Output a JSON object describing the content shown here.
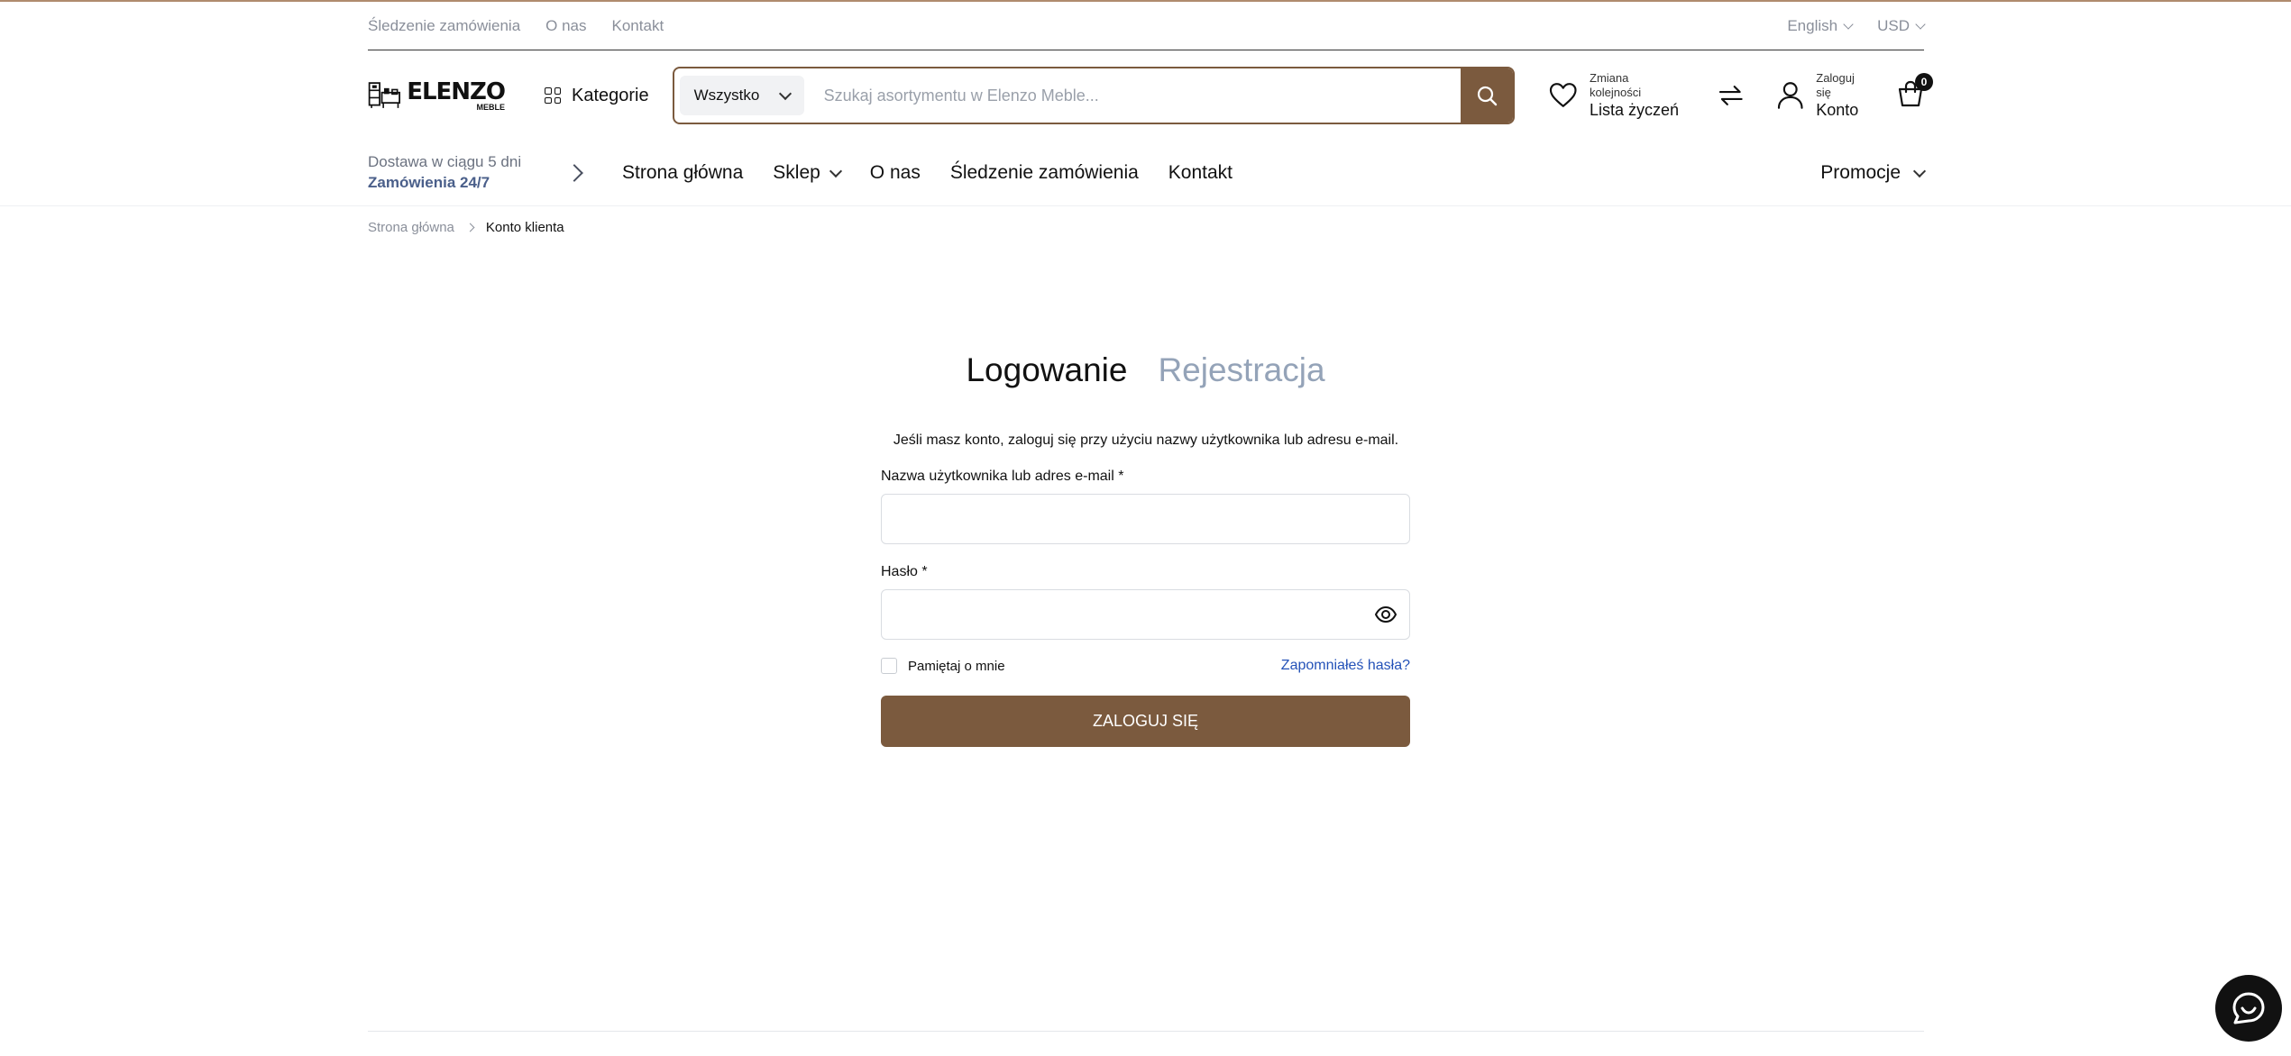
{
  "topbar": {
    "links": [
      "Śledzenie zamówienia",
      "O nas",
      "Kontakt"
    ],
    "language": "English",
    "currency": "USD"
  },
  "header": {
    "logo_brand": "ELENZO",
    "logo_sub": "MEBLE",
    "categories_label": "Kategorie",
    "search_category": "Wszystko",
    "search_placeholder": "Szukaj asortymentu w Elenzo Meble...",
    "wishlist_small": "Zmiana kolejności",
    "wishlist_big": "Lista życzeń",
    "account_small": "Zaloguj się",
    "account_big": "Konto",
    "cart_count": "0"
  },
  "nav": {
    "delivery_line1": "Dostawa w ciągu 5 dni",
    "delivery_line2": "Zamówienia 24/7",
    "items": [
      "Strona główna",
      "Sklep",
      "O nas",
      "Śledzenie zamówienia",
      "Kontakt"
    ],
    "promo": "Promocje"
  },
  "breadcrumb": {
    "home": "Strona główna",
    "current": "Konto klienta"
  },
  "login": {
    "tab_login": "Logowanie",
    "tab_register": "Rejestracja",
    "intro": "Jeśli masz konto, zaloguj się przy użyciu nazwy użytkownika lub adresu e-mail.",
    "username_label": "Nazwa użytkownika lub adres e-mail *",
    "password_label": "Hasło *",
    "remember_label": "Pamiętaj o mnie",
    "forgot_label": "Zapomniałeś hasła?",
    "submit_label": "ZALOGUJ SIĘ"
  },
  "colors": {
    "accent": "#7b5a3e",
    "link": "#2452b8",
    "muted": "#8a8f9a"
  }
}
